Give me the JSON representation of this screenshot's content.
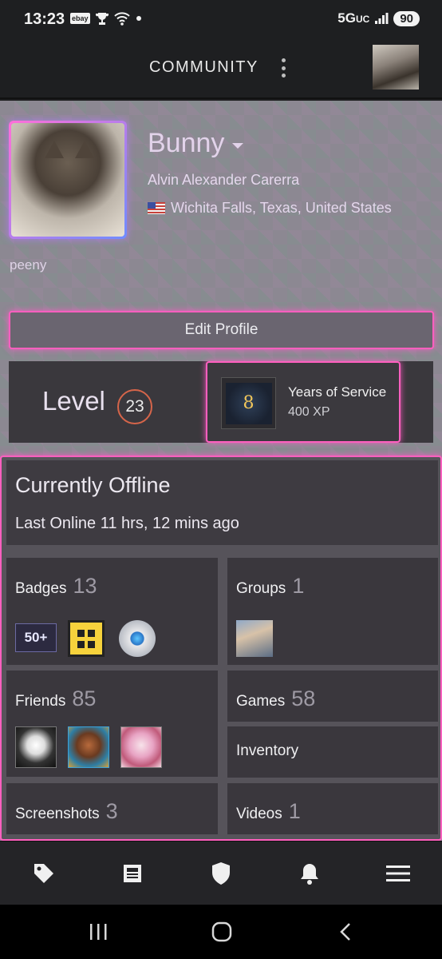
{
  "status_bar": {
    "time": "13:23",
    "ebay": "ebay",
    "network": "5G",
    "network_suffix": "UC",
    "battery": "90"
  },
  "header": {
    "title": "COMMUNITY"
  },
  "profile": {
    "persona_name": "Bunny",
    "real_name": "Alvin Alexander Carerra",
    "location": "Wichita Falls, Texas, United States",
    "summary": "peeny",
    "edit_label": "Edit Profile",
    "level_label": "Level",
    "level_value": "23",
    "badge_title": "Years of Service",
    "badge_xp": "400 XP",
    "badge_icon_text": "8"
  },
  "status": {
    "title": "Currently Offline",
    "last_online": "Last Online 11 hrs, 12 mins ago"
  },
  "tiles": {
    "badges": {
      "label": "Badges",
      "count": "13",
      "first_badge_text": "50+"
    },
    "groups": {
      "label": "Groups",
      "count": "1"
    },
    "friends": {
      "label": "Friends",
      "count": "85"
    },
    "games": {
      "label": "Games",
      "count": "58"
    },
    "inventory": {
      "label": "Inventory"
    },
    "screenshots": {
      "label": "Screenshots",
      "count": "3"
    },
    "videos": {
      "label": "Videos",
      "count": "1"
    }
  },
  "colors": {
    "accent_pink": "#ff5fbf",
    "level_ring": "#d6654a",
    "panel": "#3a373d"
  },
  "bottom_nav": [
    "tag-icon",
    "news-icon",
    "shield-icon",
    "bell-icon",
    "menu-icon"
  ],
  "system_nav": [
    "recents-icon",
    "home-icon",
    "back-icon"
  ]
}
